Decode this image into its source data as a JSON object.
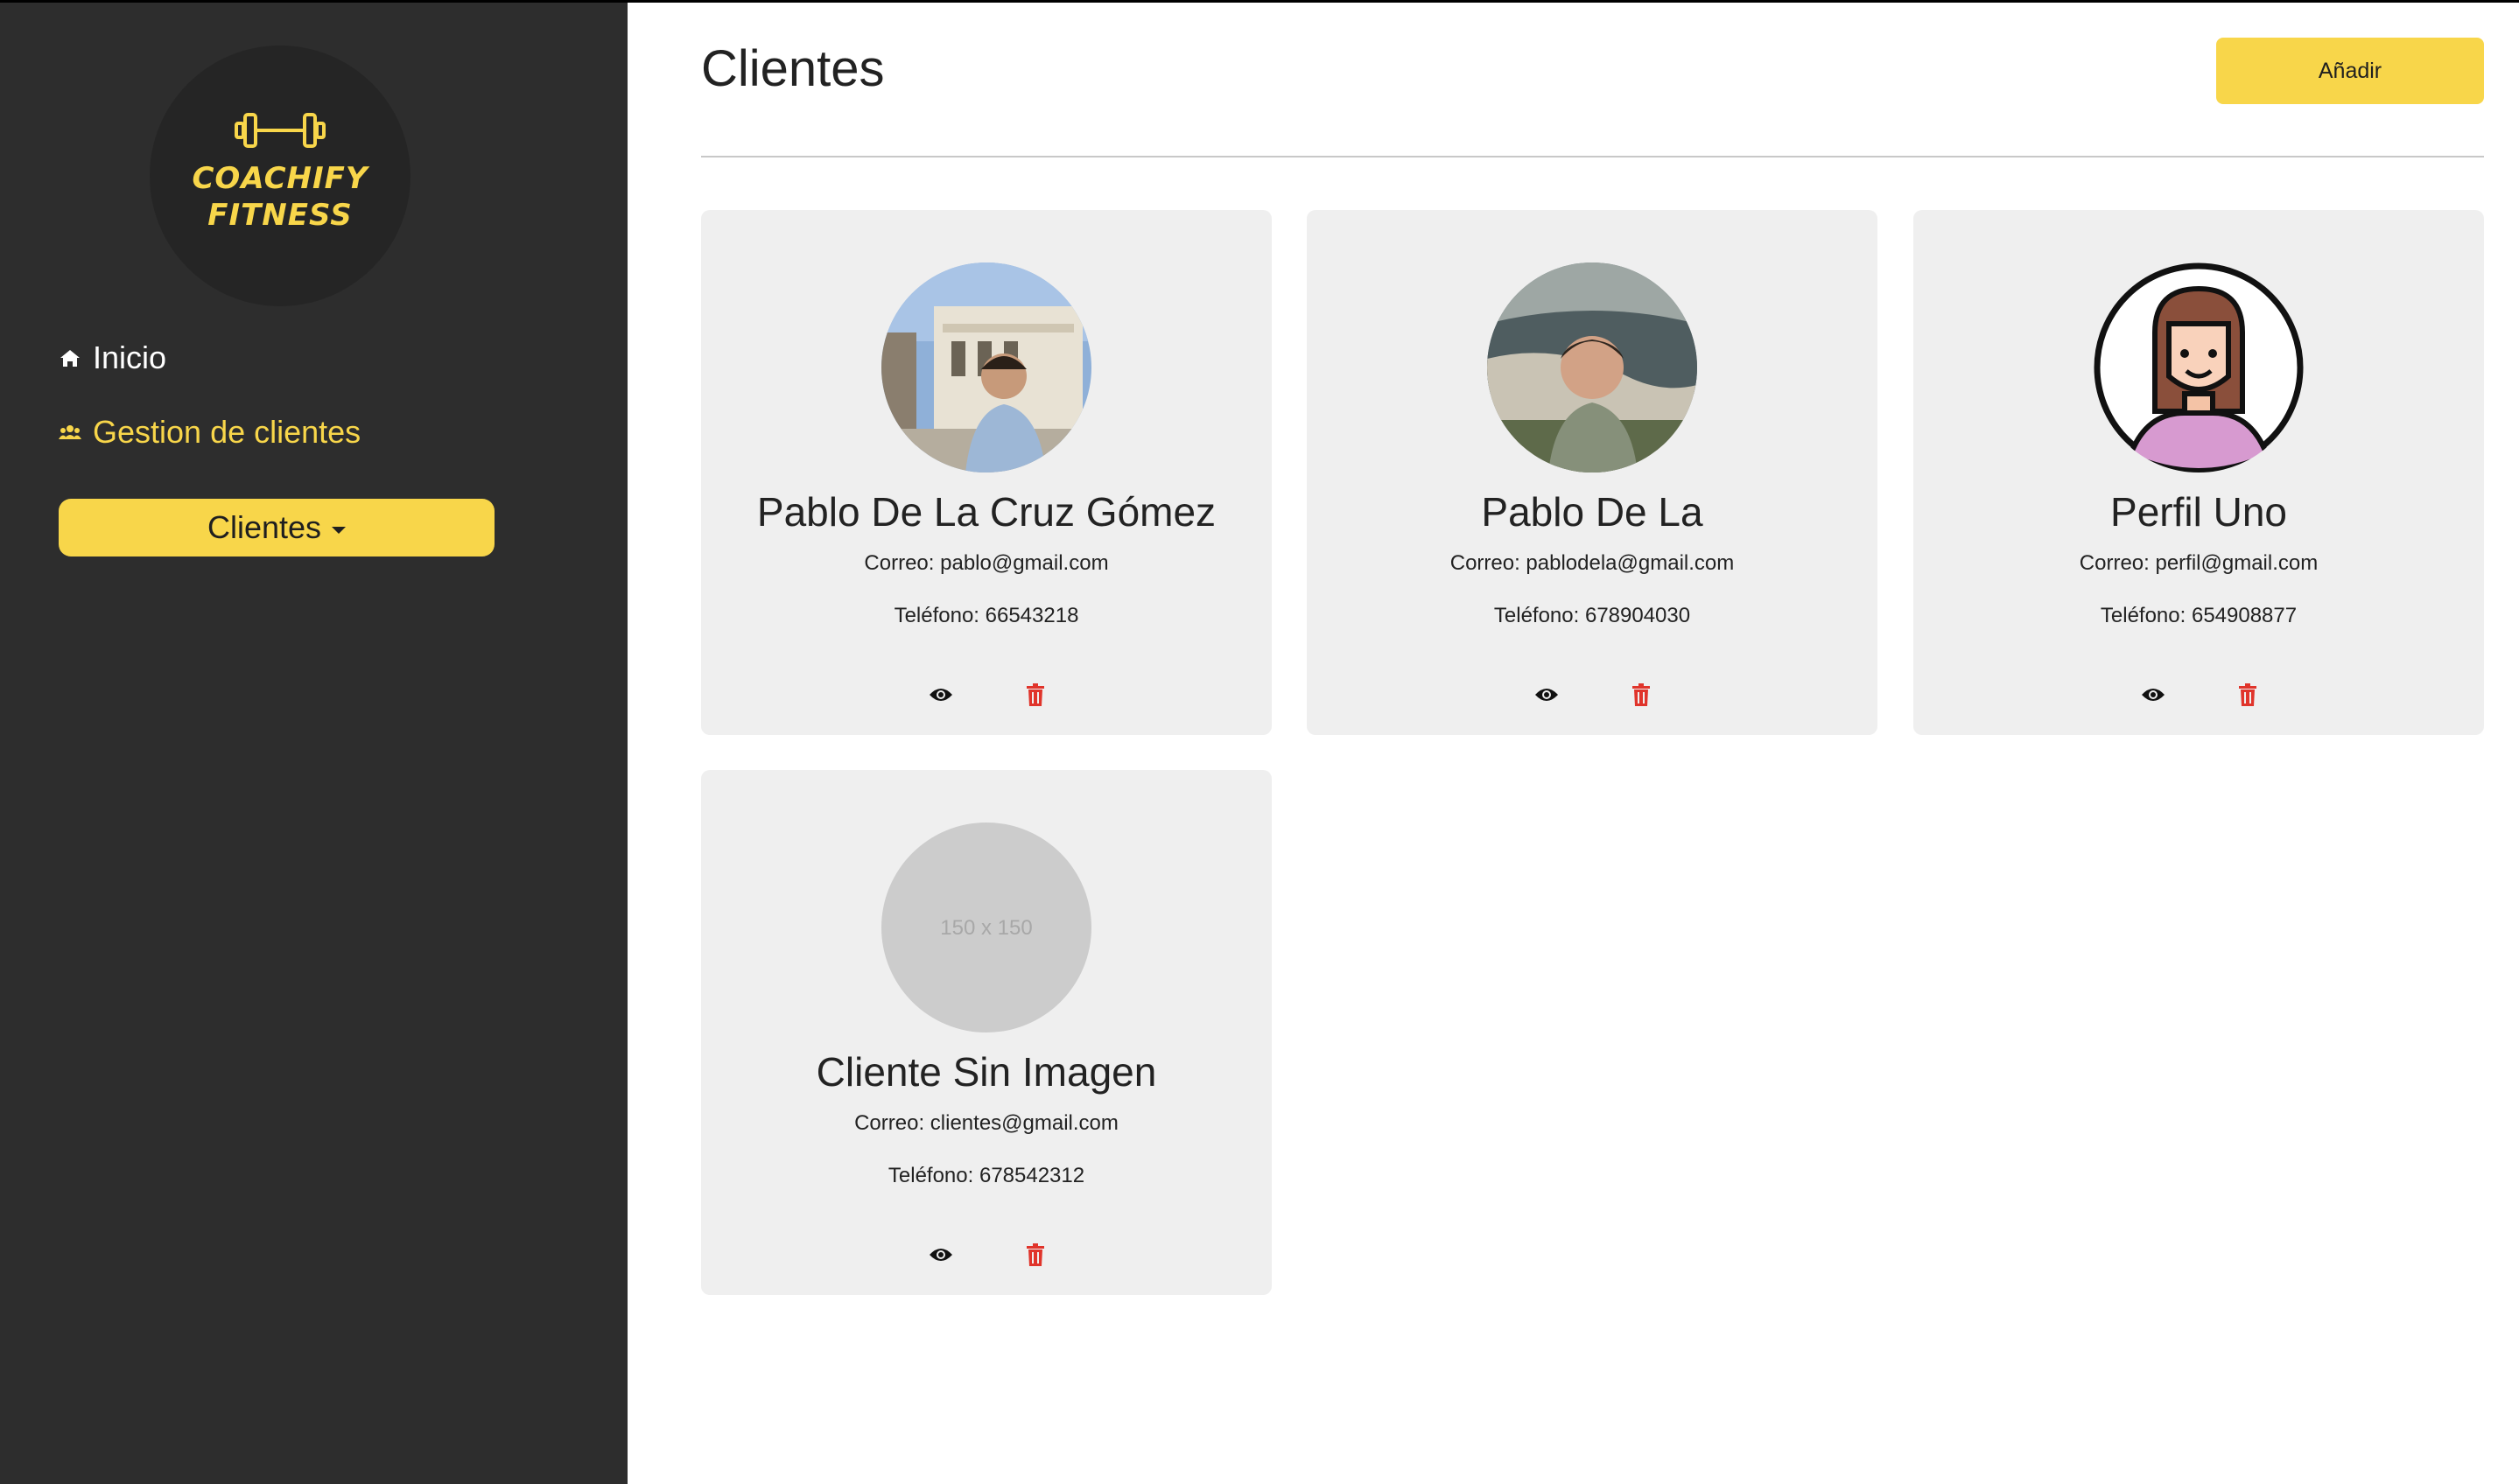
{
  "sidebar": {
    "logo": {
      "line1": "COACHIFY",
      "line2": "FITNESS",
      "icon": "dumbbell-icon"
    },
    "nav": {
      "inicio": {
        "label": "Inicio",
        "icon": "home-icon"
      },
      "gestion": {
        "label": "Gestion de clientes",
        "icon": "users-icon"
      }
    },
    "dropdown": {
      "label": "Clientes"
    }
  },
  "header": {
    "title": "Clientes",
    "add_label": "Añadir"
  },
  "clients": [
    {
      "name": "Pablo De La Cruz Gómez",
      "email": "Correo: pablo@gmail.com",
      "phone": "Teléfono: 66543218"
    },
    {
      "name": "Pablo De La",
      "email": "Correo: pablodela@gmail.com",
      "phone": "Teléfono: 678904030"
    },
    {
      "name": "Perfil Uno",
      "email": "Correo: perfil@gmail.com",
      "phone": "Teléfono: 654908877"
    },
    {
      "name": "Cliente Sin Imagen",
      "email": "Correo: clientes@gmail.com",
      "phone": "Teléfono: 678542312",
      "placeholder": "150 x 150"
    }
  ],
  "colors": {
    "accent": "#f8d64a",
    "sidebar_bg": "#2d2d2d",
    "card_bg": "#efefef",
    "delete": "#e0342b"
  }
}
